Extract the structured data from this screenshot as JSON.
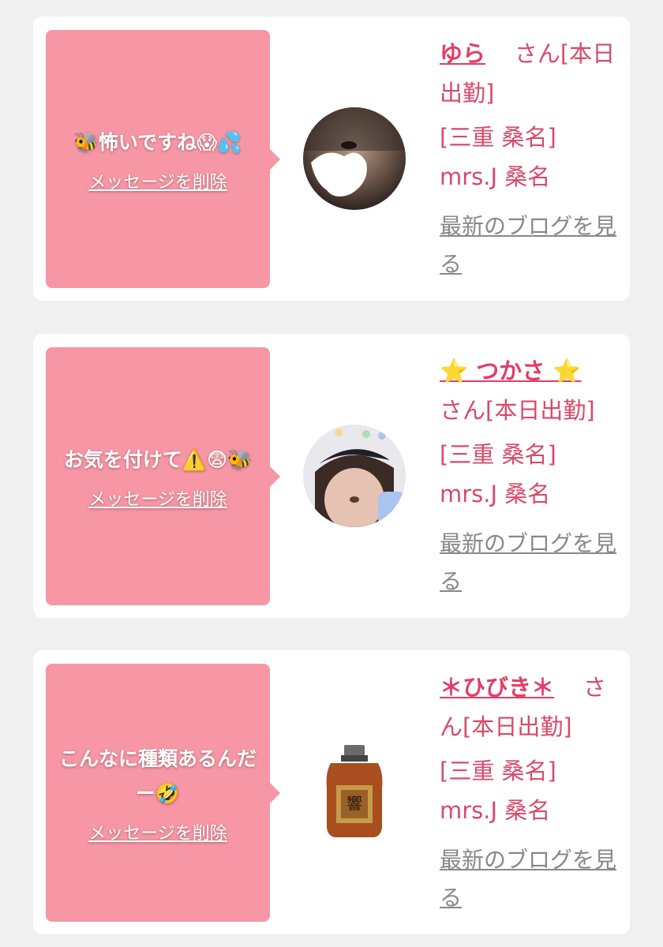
{
  "cards": [
    {
      "message": "🐝怖いですね😱💦",
      "delete_label": "メッセージを削除",
      "name": "ゆら",
      "honorific_status": "さん[本日出勤]",
      "location": "[三重 桑名] mrs.J 桑名",
      "blog_link": "最新のブログを見る"
    },
    {
      "message": "お気を付けて⚠️😨🐝",
      "delete_label": "メッセージを削除",
      "name": "⭐️ つかさ ⭐️",
      "honorific_status": "さん[本日出勤]",
      "location": "[三重 桑名] mrs.J 桑名",
      "blog_link": "最新のブログを見る"
    },
    {
      "message": "こんなに種類あるんだー🤣",
      "delete_label": "メッセージを削除",
      "name": "＊ひびき＊",
      "honorific_status": "さん[本日出勤]",
      "location": "[三重 桑名] mrs.J 桑名",
      "blog_link": "最新のブログを見る"
    }
  ],
  "colors": {
    "bubble": "#f796a4",
    "name": "#e23d66",
    "info_text": "#d84a6a",
    "link_gray": "#888888"
  }
}
